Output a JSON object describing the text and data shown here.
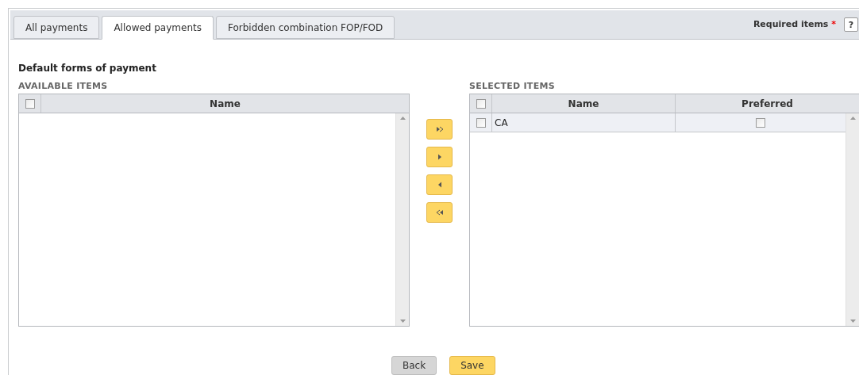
{
  "tabs": [
    {
      "label": "All payments",
      "selected": false
    },
    {
      "label": "Allowed payments",
      "selected": true
    },
    {
      "label": "Forbidden combination FOP/FOD",
      "selected": false
    }
  ],
  "required": {
    "label": "Required items",
    "mark": "*"
  },
  "help": {
    "label": "?"
  },
  "section_title": "Default forms of payment",
  "available": {
    "title": "AVAILABLE ITEMS",
    "columns": [
      "Name"
    ],
    "all_checked": false
  },
  "transfer_buttons": [
    {
      "kind": "all_right"
    },
    {
      "kind": "right"
    },
    {
      "kind": "left"
    },
    {
      "kind": "all_left"
    }
  ],
  "selected": {
    "title": "SELECTED ITEMS",
    "columns": [
      "Name",
      "Preferred"
    ],
    "all_checked": false,
    "rows": [
      {
        "name": "CA",
        "checked": false,
        "preferred": false
      }
    ]
  },
  "buttons": [
    {
      "label": "Back",
      "kind": "secondary"
    },
    {
      "label": "Save",
      "kind": "primary"
    }
  ]
}
